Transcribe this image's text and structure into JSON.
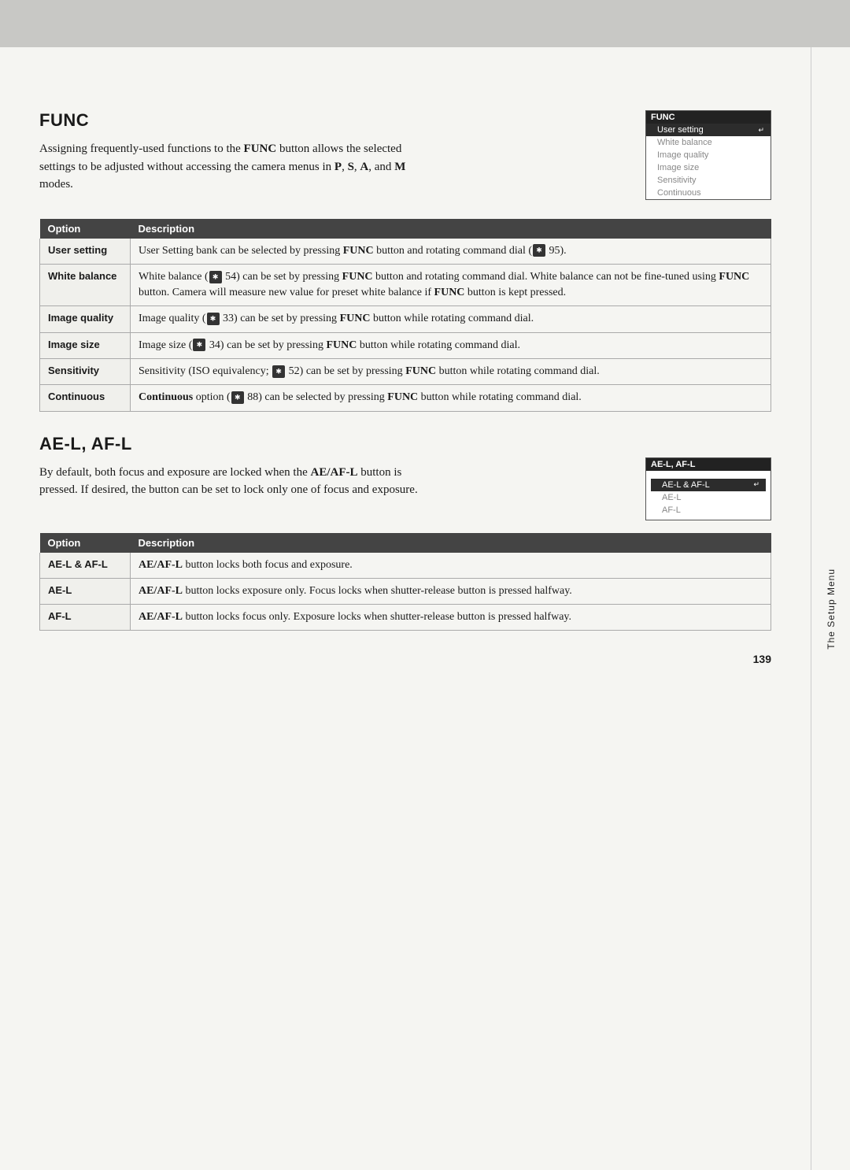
{
  "topbar": {},
  "func_section": {
    "title": "FUNC",
    "intro": "Assigning frequently-used functions to the FUNC button allows the selected settings to be adjusted without accessing the camera menus in P, S, A, and M modes.",
    "menu": {
      "title": "FUNC",
      "items": [
        {
          "label": "User setting",
          "selected": true
        },
        {
          "label": "White balance",
          "selected": false
        },
        {
          "label": "Image quality",
          "selected": false
        },
        {
          "label": "Image size",
          "selected": false
        },
        {
          "label": "Sensitivity",
          "selected": false
        },
        {
          "label": "Continuous",
          "selected": false
        }
      ]
    },
    "table": {
      "col1_header": "Option",
      "col2_header": "Description",
      "rows": [
        {
          "option": "User setting",
          "description": "User Setting bank can be selected by pressing FUNC button and rotating command dial (⚙ 95)."
        },
        {
          "option": "White balance",
          "description": "White balance (⚙ 54) can be set by pressing FUNC button and rotating command dial.  White balance can not be fine-tuned using FUNC button.  Camera will measure new value for preset white balance if FUNC button is kept pressed."
        },
        {
          "option": "Image quality",
          "description": "Image quality (⚙ 33) can be set by pressing FUNC button while rotating command dial."
        },
        {
          "option": "Image size",
          "description": "Image size (⚙ 34) can be set by pressing FUNC button while rotating command dial."
        },
        {
          "option": "Sensitivity",
          "description": "Sensitivity (ISO equivalency; ⚙ 52) can be set by pressing FUNC button while rotating command dial."
        },
        {
          "option": "Continuous",
          "description": "Continuous option (⚙ 88) can be selected by pressing FUNC button while rotating command dial."
        }
      ]
    }
  },
  "ae_section": {
    "title": "AE-L, AF-L",
    "intro": "By default, both focus and exposure are locked when the AE/AF-L button is pressed.  If desired, the button can be set to lock only one of focus and exposure.",
    "menu": {
      "title": "AE-L, AF-L",
      "items": [
        {
          "label": "AE-L & AF-L",
          "selected": true
        },
        {
          "label": "AE-L",
          "selected": false
        },
        {
          "label": "AF-L",
          "selected": false
        }
      ]
    },
    "table": {
      "col1_header": "Option",
      "col2_header": "Description",
      "rows": [
        {
          "option": "AE-L & AF-L",
          "description": "AE/AF-L button locks both focus and exposure."
        },
        {
          "option": "AE-L",
          "description": "AE/AF-L button locks exposure only.  Focus locks when shutter-release button is pressed halfway."
        },
        {
          "option": "AF-L",
          "description": "AE/AF-L button locks focus only.  Exposure locks when shutter-release button is pressed halfway."
        }
      ]
    }
  },
  "sidebar": {
    "label": "The Setup Menu"
  },
  "footer": {
    "page_number": "139"
  }
}
